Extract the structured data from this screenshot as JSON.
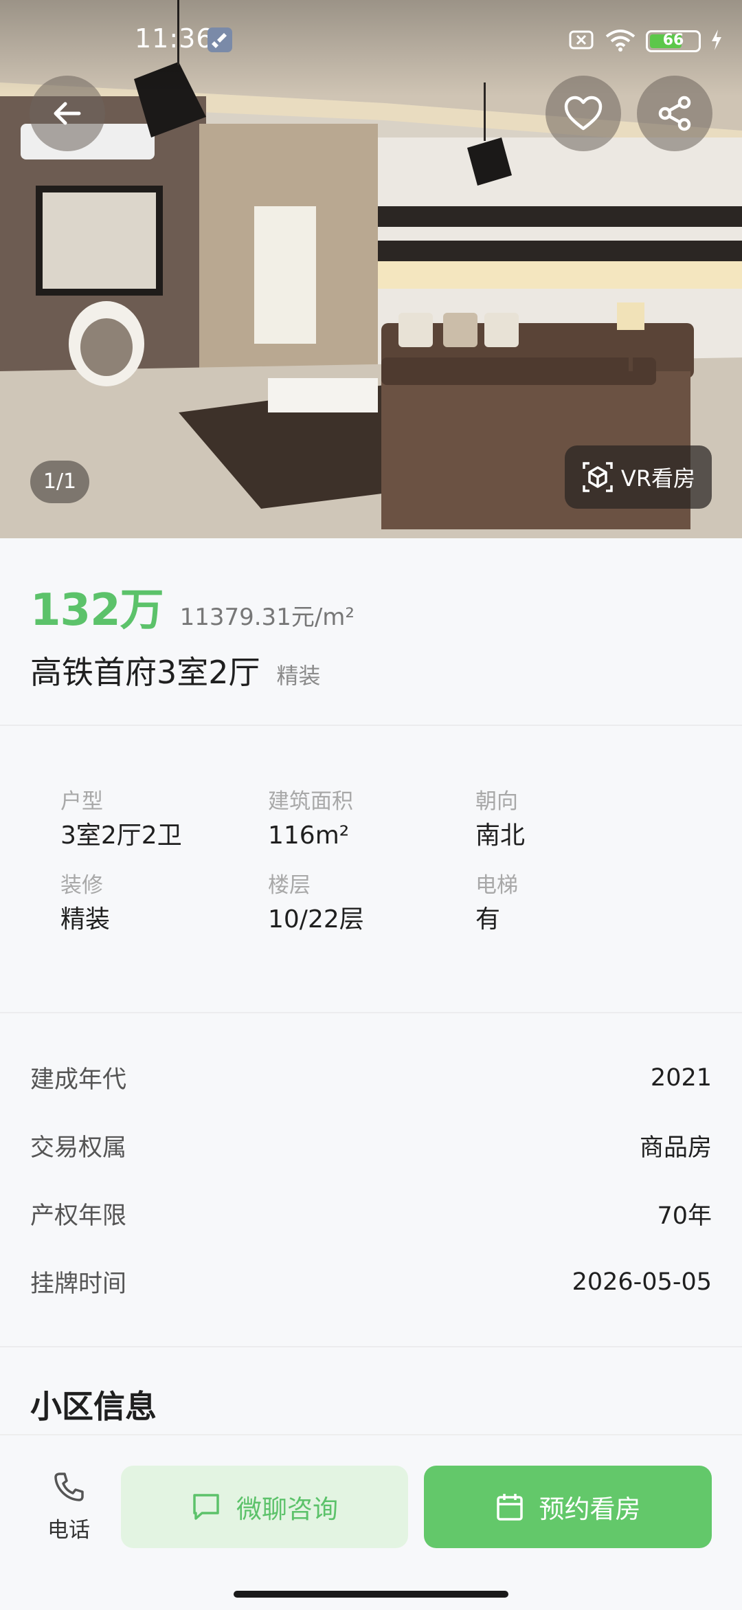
{
  "status_bar": {
    "time": "11:36",
    "battery": "66",
    "icons": [
      "wrench-icon",
      "sim-off-icon",
      "wifi-icon",
      "battery-icon",
      "charging-icon"
    ]
  },
  "hero": {
    "counter": "1/1",
    "vr_label": "VR看房",
    "icons": [
      "back-arrow-icon",
      "heart-icon",
      "share-icon",
      "vr-cube-icon"
    ]
  },
  "listing": {
    "price_total": "132万",
    "price_unit": "11379.31元/m²",
    "title": "高铁首府3室2厅",
    "tag": "精装"
  },
  "specs": [
    {
      "label": "户型",
      "value": "3室2厅2卫"
    },
    {
      "label": "建筑面积",
      "value": "116m²"
    },
    {
      "label": "朝向",
      "value": "南北"
    },
    {
      "label": "装修",
      "value": "精装"
    },
    {
      "label": "楼层",
      "value": "10/22层"
    },
    {
      "label": "电梯",
      "value": "有"
    }
  ],
  "info": [
    {
      "label": "建成年代",
      "value": "2021"
    },
    {
      "label": "交易权属",
      "value": "商品房"
    },
    {
      "label": "产权年限",
      "value": "70年"
    },
    {
      "label": "挂牌时间",
      "value": "2026-05-05"
    }
  ],
  "section": {
    "community_title": "小区信息"
  },
  "bottom_bar": {
    "phone_label": "电话",
    "chat_label": "微聊咨询",
    "book_label": "预约看房"
  },
  "colors": {
    "accent_green": "#5cc26a",
    "accent_green_light": "#e3f4e2",
    "background": "#f7f8fa"
  }
}
